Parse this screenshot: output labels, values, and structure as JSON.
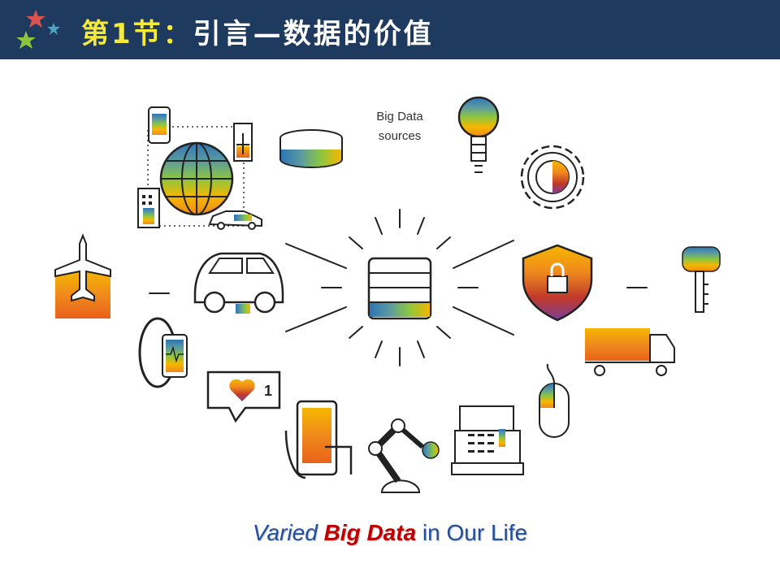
{
  "header": {
    "title_prefix": "第1节：",
    "title_main": "引言—数据的价值"
  },
  "diagram": {
    "center_label": "Big Data\nsources",
    "icons": [
      "globe-icon",
      "phone-icon",
      "building-icon",
      "plane-icon",
      "car-icon",
      "database-icon",
      "lightbulb-icon",
      "gear-icon",
      "shield-lock-icon",
      "key-icon",
      "truck-icon",
      "mouse-icon",
      "cash-register-icon",
      "robot-arm-icon",
      "smartphone-hand-icon",
      "like-notification-icon",
      "wearable-band-icon",
      "electric-car-icon",
      "cargo-plane-icon"
    ]
  },
  "caption": {
    "part1": "Varied ",
    "part2": "Big Data",
    "part3": " in Our Life"
  },
  "colors": {
    "header_bg": "#1e3a5f",
    "title_prefix": "#f5ea3a",
    "caption_blue": "#1f4e9c",
    "caption_red": "#c00000",
    "orange": "#f08a1c",
    "yellow": "#f5b700",
    "green": "#8cc63f",
    "teal": "#5b9aa0",
    "blue": "#2e75b6",
    "purple": "#7b3f97"
  }
}
